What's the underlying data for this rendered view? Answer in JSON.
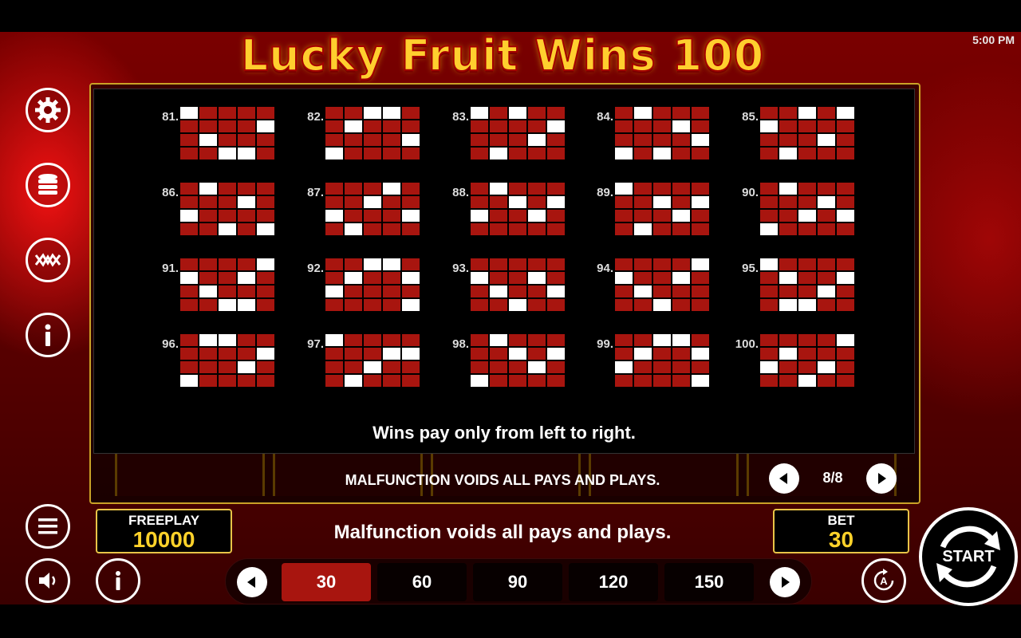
{
  "status": {
    "time": "5:00 PM"
  },
  "title": "Lucky Fruit Wins 100",
  "side_menu": [
    {
      "icon": "gear-icon"
    },
    {
      "icon": "coins-icon"
    },
    {
      "icon": "paylines-icon"
    },
    {
      "icon": "info-icon"
    }
  ],
  "paylines": [
    {
      "label": "81.",
      "rows": [
        [
          1,
          0,
          0,
          0,
          0
        ],
        [
          0,
          0,
          0,
          0,
          1
        ],
        [
          0,
          1,
          0,
          0,
          0
        ],
        [
          0,
          0,
          1,
          1,
          0
        ]
      ]
    },
    {
      "label": "82.",
      "rows": [
        [
          0,
          0,
          1,
          1,
          0
        ],
        [
          0,
          1,
          0,
          0,
          0
        ],
        [
          0,
          0,
          0,
          0,
          1
        ],
        [
          1,
          0,
          0,
          0,
          0
        ]
      ]
    },
    {
      "label": "83.",
      "rows": [
        [
          1,
          0,
          1,
          0,
          0
        ],
        [
          0,
          0,
          0,
          0,
          1
        ],
        [
          0,
          0,
          0,
          1,
          0
        ],
        [
          0,
          1,
          0,
          0,
          0
        ]
      ]
    },
    {
      "label": "84.",
      "rows": [
        [
          0,
          1,
          0,
          0,
          0
        ],
        [
          0,
          0,
          0,
          1,
          0
        ],
        [
          0,
          0,
          0,
          0,
          1
        ],
        [
          1,
          0,
          1,
          0,
          0
        ]
      ]
    },
    {
      "label": "85.",
      "rows": [
        [
          0,
          0,
          1,
          0,
          1
        ],
        [
          1,
          0,
          0,
          0,
          0
        ],
        [
          0,
          0,
          0,
          1,
          0
        ],
        [
          0,
          1,
          0,
          0,
          0
        ]
      ]
    },
    {
      "label": "86.",
      "rows": [
        [
          0,
          1,
          0,
          0,
          0
        ],
        [
          0,
          0,
          0,
          1,
          0
        ],
        [
          1,
          0,
          0,
          0,
          0
        ],
        [
          0,
          0,
          1,
          0,
          1
        ]
      ]
    },
    {
      "label": "87.",
      "rows": [
        [
          0,
          0,
          0,
          1,
          0
        ],
        [
          0,
          0,
          1,
          0,
          0
        ],
        [
          1,
          0,
          0,
          0,
          1
        ],
        [
          0,
          1,
          0,
          0,
          0
        ]
      ]
    },
    {
      "label": "88.",
      "rows": [
        [
          0,
          1,
          0,
          0,
          0
        ],
        [
          0,
          0,
          1,
          0,
          1
        ],
        [
          1,
          0,
          0,
          1,
          0
        ],
        [
          0,
          0,
          0,
          0,
          0
        ]
      ]
    },
    {
      "label": "89.",
      "rows": [
        [
          1,
          0,
          0,
          0,
          0
        ],
        [
          0,
          0,
          1,
          0,
          1
        ],
        [
          0,
          0,
          0,
          1,
          0
        ],
        [
          0,
          1,
          0,
          0,
          0
        ]
      ]
    },
    {
      "label": "90.",
      "rows": [
        [
          0,
          1,
          0,
          0,
          0
        ],
        [
          0,
          0,
          0,
          1,
          0
        ],
        [
          0,
          0,
          1,
          0,
          1
        ],
        [
          1,
          0,
          0,
          0,
          0
        ]
      ]
    },
    {
      "label": "91.",
      "rows": [
        [
          0,
          0,
          0,
          0,
          1
        ],
        [
          1,
          0,
          0,
          1,
          0
        ],
        [
          0,
          1,
          0,
          0,
          0
        ],
        [
          0,
          0,
          1,
          1,
          0
        ]
      ]
    },
    {
      "label": "92.",
      "rows": [
        [
          0,
          0,
          1,
          1,
          0
        ],
        [
          0,
          1,
          0,
          0,
          1
        ],
        [
          1,
          0,
          0,
          0,
          0
        ],
        [
          0,
          0,
          0,
          0,
          1
        ]
      ]
    },
    {
      "label": "93.",
      "rows": [
        [
          0,
          0,
          0,
          0,
          0
        ],
        [
          1,
          0,
          0,
          1,
          0
        ],
        [
          0,
          1,
          0,
          0,
          1
        ],
        [
          0,
          0,
          1,
          0,
          0
        ]
      ]
    },
    {
      "label": "94.",
      "rows": [
        [
          0,
          0,
          0,
          0,
          1
        ],
        [
          1,
          0,
          0,
          1,
          0
        ],
        [
          0,
          1,
          0,
          0,
          0
        ],
        [
          0,
          0,
          1,
          0,
          0
        ]
      ]
    },
    {
      "label": "95.",
      "rows": [
        [
          1,
          0,
          0,
          0,
          0
        ],
        [
          0,
          1,
          0,
          0,
          1
        ],
        [
          0,
          0,
          0,
          1,
          0
        ],
        [
          0,
          1,
          1,
          0,
          0
        ]
      ]
    },
    {
      "label": "96.",
      "rows": [
        [
          0,
          1,
          1,
          0,
          0
        ],
        [
          0,
          0,
          0,
          0,
          1
        ],
        [
          0,
          0,
          0,
          1,
          0
        ],
        [
          1,
          0,
          0,
          0,
          0
        ]
      ]
    },
    {
      "label": "97.",
      "rows": [
        [
          1,
          0,
          0,
          0,
          0
        ],
        [
          0,
          0,
          0,
          1,
          1
        ],
        [
          0,
          0,
          1,
          0,
          0
        ],
        [
          0,
          1,
          0,
          0,
          0
        ]
      ]
    },
    {
      "label": "98.",
      "rows": [
        [
          0,
          1,
          0,
          0,
          0
        ],
        [
          0,
          0,
          1,
          0,
          1
        ],
        [
          0,
          0,
          0,
          1,
          0
        ],
        [
          1,
          0,
          0,
          0,
          0
        ]
      ]
    },
    {
      "label": "99.",
      "rows": [
        [
          0,
          0,
          1,
          1,
          0
        ],
        [
          0,
          1,
          0,
          0,
          1
        ],
        [
          1,
          0,
          0,
          0,
          0
        ],
        [
          0,
          0,
          0,
          0,
          1
        ]
      ]
    },
    {
      "label": "100.",
      "rows": [
        [
          0,
          0,
          0,
          0,
          1
        ],
        [
          0,
          1,
          0,
          0,
          0
        ],
        [
          1,
          0,
          0,
          1,
          0
        ],
        [
          0,
          0,
          1,
          0,
          0
        ]
      ]
    }
  ],
  "wins_note": "Wins pay only from left to right.",
  "malfunction_upper": "MALFUNCTION VOIDS ALL PAYS AND PLAYS.",
  "pager": {
    "text": "8/8"
  },
  "freeplay": {
    "label": "FREEPLAY",
    "value": "10000"
  },
  "bet": {
    "label": "BET",
    "value": "30"
  },
  "malfunction_lower": "Malfunction voids all pays and plays.",
  "bet_options": [
    "30",
    "60",
    "90",
    "120",
    "150"
  ],
  "selected_bet_index": 0,
  "start_label": "START",
  "colors": {
    "accent_gold": "#e8c447",
    "bet_selected": "#a8150f",
    "payline_cell": "#a8150f",
    "value_yellow": "#ffd22a"
  }
}
